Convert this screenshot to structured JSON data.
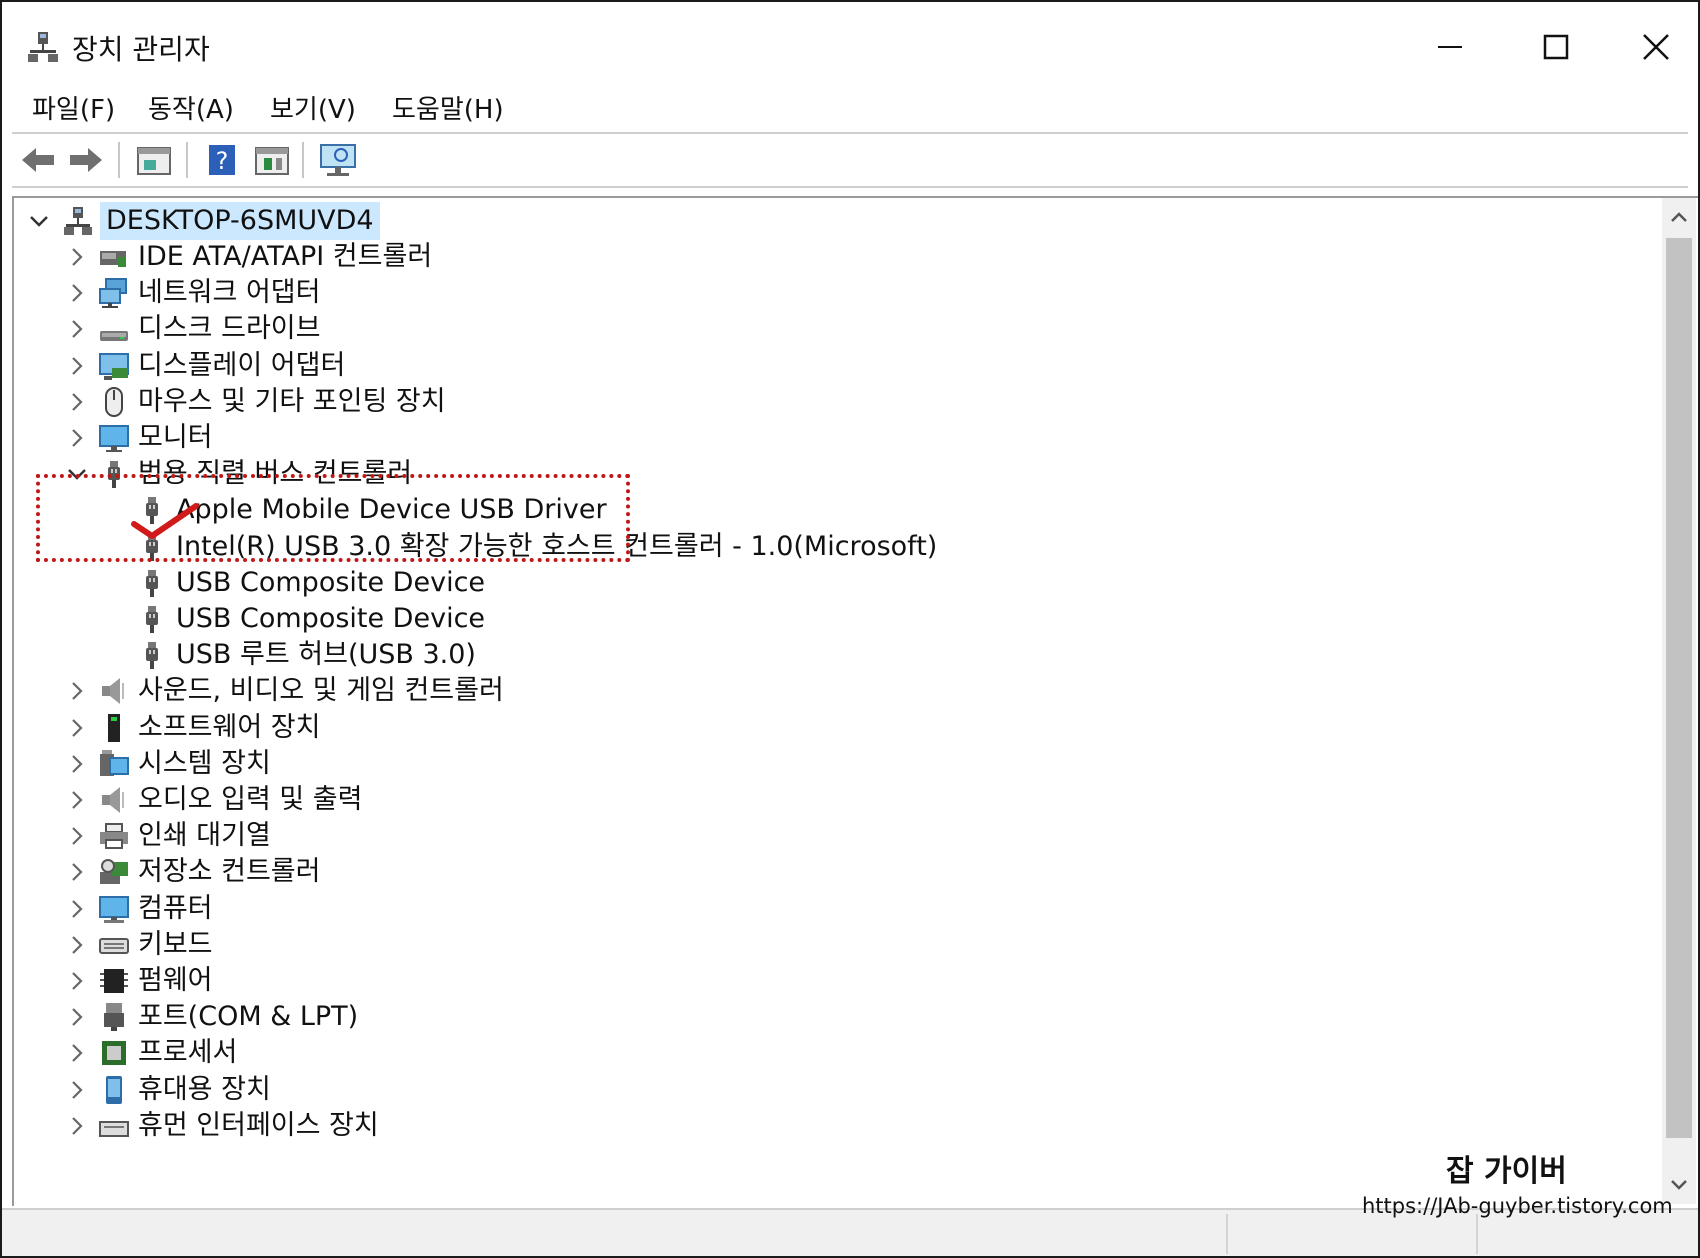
{
  "window": {
    "title": "장치 관리자",
    "controls": [
      "minimize",
      "maximize",
      "close"
    ]
  },
  "menu": [
    {
      "label": "파일(F)"
    },
    {
      "label": "동작(A)"
    },
    {
      "label": "보기(V)"
    },
    {
      "label": "도움말(H)"
    }
  ],
  "toolbar": [
    "back-arrow-icon",
    "forward-arrow-icon",
    "properties-icon",
    "help-icon",
    "update-driver-icon",
    "scan-hardware-icon"
  ],
  "tree": {
    "root": {
      "label": "DESKTOP-6SMUVD4",
      "expanded": true
    },
    "items": [
      {
        "label": "IDE ATA/ATAPI 컨트롤러",
        "icon": "ide-controller-icon"
      },
      {
        "label": "네트워크 어댑터",
        "icon": "network-adapter-icon"
      },
      {
        "label": "디스크 드라이브",
        "icon": "disk-drive-icon"
      },
      {
        "label": "디스플레이 어댑터",
        "icon": "display-adapter-icon"
      },
      {
        "label": "마우스 및 기타 포인팅 장치",
        "icon": "mouse-icon"
      },
      {
        "label": "모니터",
        "icon": "monitor-icon"
      },
      {
        "label": "범용 직렬 버스 컨트롤러",
        "icon": "usb-icon",
        "expanded": true
      },
      {
        "label": "Apple Mobile Device USB Driver",
        "icon": "usb-icon",
        "child": true
      },
      {
        "label": "Intel(R) USB 3.0 확장 가능한 호스트 컨트롤러 - 1.0(Microsoft)",
        "icon": "usb-icon",
        "child": true
      },
      {
        "label": "USB Composite Device",
        "icon": "usb-icon",
        "child": true
      },
      {
        "label": "USB Composite Device",
        "icon": "usb-icon",
        "child": true
      },
      {
        "label": "USB 루트 허브(USB 3.0)",
        "icon": "usb-icon",
        "child": true
      },
      {
        "label": "사운드, 비디오 및 게임 컨트롤러",
        "icon": "speaker-icon"
      },
      {
        "label": "소프트웨어 장치",
        "icon": "software-device-icon"
      },
      {
        "label": "시스템 장치",
        "icon": "system-device-icon"
      },
      {
        "label": "오디오 입력 및 출력",
        "icon": "speaker-icon"
      },
      {
        "label": "인쇄 대기열",
        "icon": "printer-icon"
      },
      {
        "label": "저장소 컨트롤러",
        "icon": "storage-controller-icon"
      },
      {
        "label": "컴퓨터",
        "icon": "computer-icon"
      },
      {
        "label": "키보드",
        "icon": "keyboard-icon"
      },
      {
        "label": "펌웨어",
        "icon": "firmware-icon"
      },
      {
        "label": "포트(COM & LPT)",
        "icon": "port-icon"
      },
      {
        "label": "프로세서",
        "icon": "processor-icon"
      },
      {
        "label": "휴대용 장치",
        "icon": "portable-device-icon"
      },
      {
        "label": "휴먼 인터페이스 장치",
        "icon": "hid-icon"
      }
    ]
  },
  "colors": {
    "selection": "#cce8ff",
    "annotation": "#c01818"
  },
  "watermark": {
    "title": "잡 가이버",
    "url": "https://JAb-guyber.tistory.com"
  }
}
